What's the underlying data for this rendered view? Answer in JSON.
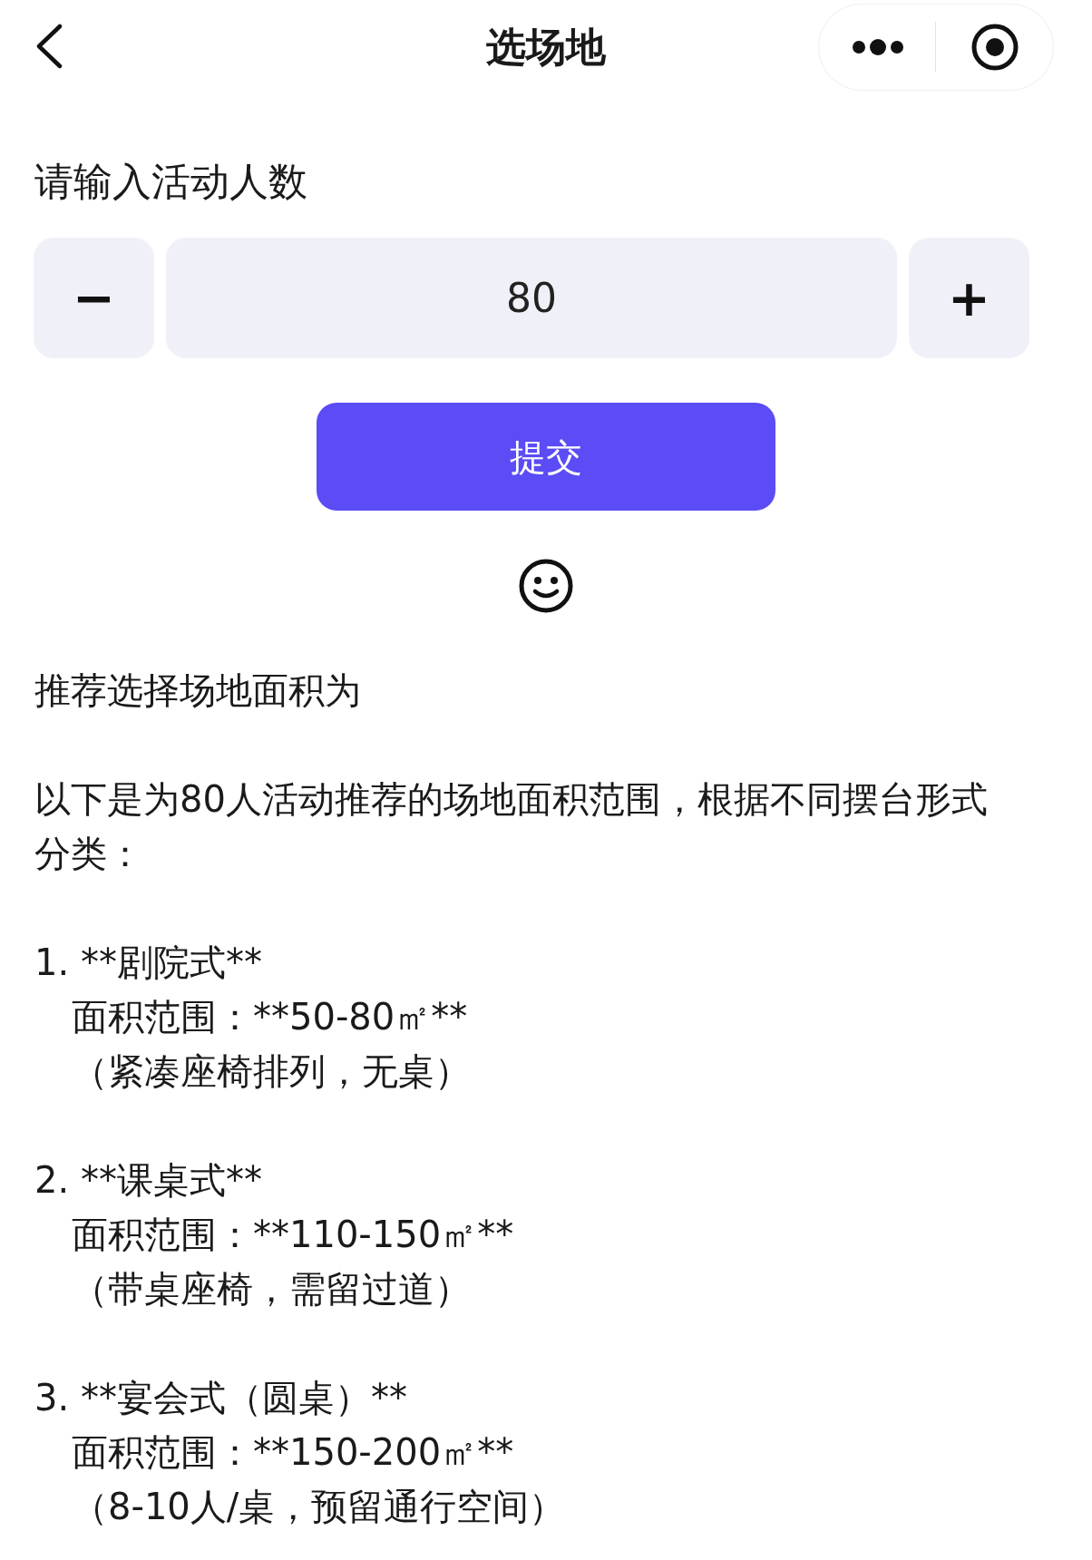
{
  "nav": {
    "title": "选场地"
  },
  "prompt": "请输入活动人数",
  "stepper": {
    "minus": "−",
    "value": "80",
    "plus": "+"
  },
  "submit": "提交",
  "result": {
    "intro": "推荐选择场地面积为",
    "summary": "以下是为80人活动推荐的场地面积范围，根据不同摆台形式分类：",
    "items": [
      {
        "heading": "1. **剧院式**",
        "lines": [
          "面积范围：**50-80㎡**",
          "（紧凑座椅排列，无桌）"
        ]
      },
      {
        "heading": "2. **课桌式**",
        "lines": [
          "面积范围：**110-150㎡**",
          "（带桌座椅，需留过道）"
        ]
      },
      {
        "heading": "3. **宴会式（圆桌）**",
        "lines": [
          "面积范围：**150-200㎡**",
          "（8-10人/桌，预留通行空间）"
        ]
      }
    ]
  }
}
